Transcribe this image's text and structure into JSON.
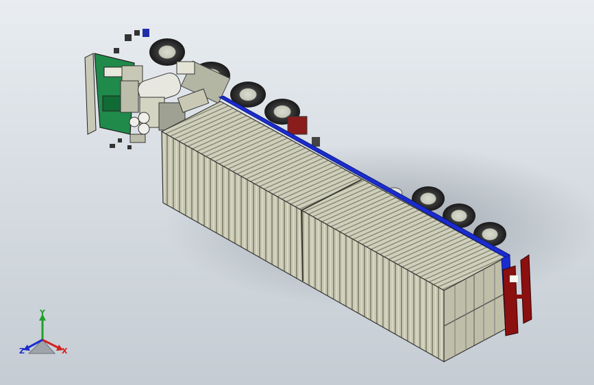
{
  "scene": {
    "subject": "cad-model-truck-with-containers",
    "colors": {
      "container": "#c8c8b4",
      "container_dark": "#8f8f78",
      "rail_blue": "#1a2ccf",
      "bracket_red": "#8b1010",
      "cab_green": "#1f8a4a",
      "tire": "#2a2a2a",
      "rim": "#d7dacc"
    }
  },
  "triad": {
    "x_label": "X",
    "y_label": "Y",
    "z_label": "Z",
    "x_color": "#d42020",
    "y_color": "#1fa02a",
    "z_color": "#1a2ccf"
  }
}
